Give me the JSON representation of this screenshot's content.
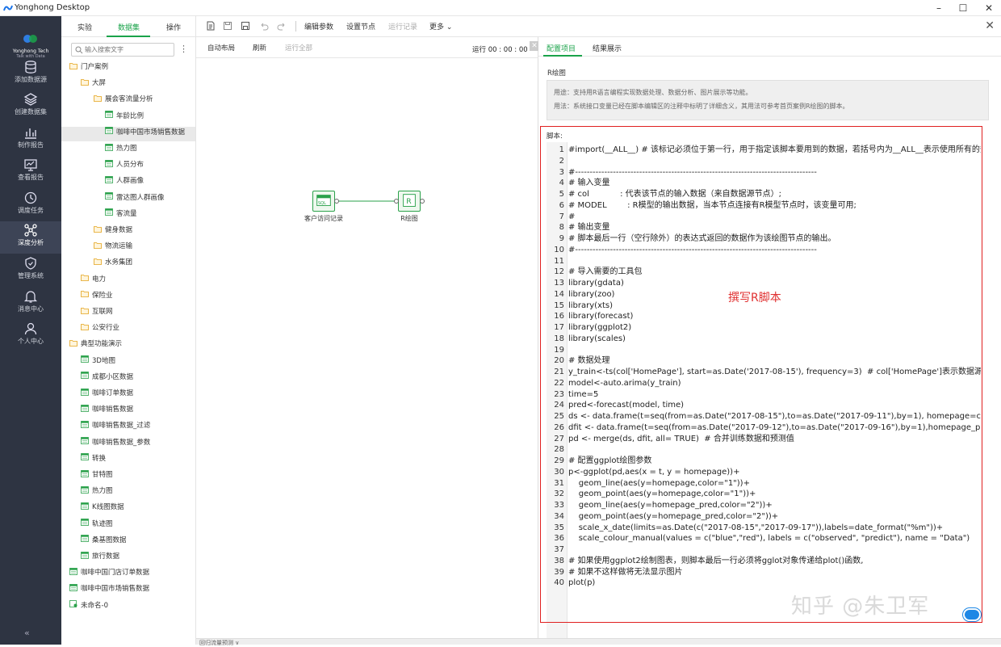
{
  "app": {
    "title": "Yonghong Desktop"
  },
  "brand": {
    "name": "Yonghong Tech",
    "tagline": "Talk with Data"
  },
  "leftnav": {
    "items": [
      {
        "label": "添加数据源",
        "icon": "database-icon"
      },
      {
        "label": "创建数据集",
        "icon": "layers-icon"
      },
      {
        "label": "制作报告",
        "icon": "bar-chart-icon"
      },
      {
        "label": "查看报告",
        "icon": "monitor-icon"
      },
      {
        "label": "调度任务",
        "icon": "clock-icon"
      },
      {
        "label": "深度分析",
        "icon": "network-icon",
        "active": true
      },
      {
        "label": "管理系统",
        "icon": "shield-icon"
      },
      {
        "label": "消息中心",
        "icon": "bell-icon"
      },
      {
        "label": "个人中心",
        "icon": "user-icon"
      }
    ],
    "collapse": "«"
  },
  "tree_tabs": {
    "experiment": "实验",
    "dataset": "数据集",
    "operation": "操作"
  },
  "search": {
    "placeholder": "输入搜索文字"
  },
  "tree": {
    "nodes": [
      "门户案例",
      "大屏",
      "展会客流量分析",
      "年龄比例",
      "咖啡中国市场销售数据",
      "热力图",
      "人员分布",
      "人群画像",
      "雷达图人群画像",
      "客流量",
      "健身数据",
      "物流运输",
      "水务集团",
      "电力",
      "保险业",
      "互联网",
      "公安行业",
      "典型功能演示",
      "3D地图",
      "成都小区数据",
      "咖啡订单数据",
      "咖啡销售数据",
      "咖啡销售数据_过滤",
      "咖啡销售数据_参数",
      "转换",
      "甘特图",
      "热力图",
      "K线图数据",
      "轨迹图",
      "桑基图数据",
      "旅行数据",
      "咖啡中国门店订单数据",
      "咖啡中国市场销售数据",
      "未命名-0"
    ]
  },
  "toolbar": {
    "edit_params": "编辑参数",
    "set_node": "设置节点",
    "run_log": "运行记录",
    "more": "更多"
  },
  "canvas": {
    "auto_layout": "自动布局",
    "refresh": "刷新",
    "run_all": "运行全部",
    "timer": "运行 00 : 00 : 00",
    "node1_label": "客户访问记录",
    "node1_icon_text": "SQL",
    "node2_label": "R绘图"
  },
  "config": {
    "tab_config": "配置项目",
    "tab_result": "结果展示",
    "section_title": "R绘图",
    "usage": "用途：支持用R语言编程实现数据处理、数据分析、图片展示等功能。",
    "usage_method": "用法：系统接口变量已经在脚本编辑区的注释中标明了详细含义，其用法可参考首页案例R绘图的脚本。",
    "script_label": "脚本:"
  },
  "code_lines": [
    "#import(__ALL__) # 该标记必须位于第一行，用于指定该脚本要用到的数据，若括号内为__ALL__表示使用所有的数据",
    "",
    "#-----------------------------------------------------------------------------------",
    "# 输入变量",
    "# col            : 代表该节点的输入数据（来自数据源节点）;",
    "# MODEL        : R模型的输出数据，当本节点连接有R模型节点时，该变量可用;",
    "#",
    "# 输出变量",
    "# 脚本最后一行（空行除外）的表达式返回的数据作为该绘图节点的输出。",
    "#-----------------------------------------------------------------------------------",
    "",
    "# 导入需要的工具包",
    "library(gdata)",
    "library(zoo)",
    "library(xts)",
    "library(forecast)",
    "library(ggplot2)",
    "library(scales)",
    "",
    "# 数据处理",
    "y_train<-ts(col['HomePage'], start=as.Date('2017-08-15'), frequency=3)  # col['HomePage']表示数据源中的HomePage列",
    "model<-auto.arima(y_train)",
    "time=5",
    "pred<-forecast(model, time)",
    "ds <- data.frame(t=seq(from=as.Date(\"2017-08-15\"),to=as.Date(\"2017-09-11\"),by=1), homepage=col$HomePage)",
    "dfit <- data.frame(t=seq(from=as.Date(\"2017-09-12\"),to=as.Date(\"2017-09-16\"),by=1),homepage_pred=pred$mean)",
    "pd <- merge(ds, dfit, all= TRUE)  # 合并训练数据和预测值",
    "",
    "# 配置ggplot绘图参数",
    "p<-ggplot(pd,aes(x = t, y = homepage))+",
    "    geom_line(aes(y=homepage,color=\"1\"))+",
    "    geom_point(aes(y=homepage,color=\"1\"))+",
    "    geom_line(aes(y=homepage_pred,color=\"2\"))+",
    "    geom_point(aes(y=homepage_pred,color=\"2\"))+",
    "    scale_x_date(limits=as.Date(c(\"2017-08-15\",\"2017-09-17\")),labels=date_format(\"%m\"))+",
    "    scale_colour_manual(values = c(\"blue\",\"red\"), labels = c(\"observed\", \"predict\"), name = \"Data\")",
    "",
    "# 如果使用ggplot2绘制图表，则脚本最后一行必须将gglot对象传递给plot()函数,",
    "# 如果不这样做将无法显示图片",
    "plot(p)"
  ],
  "annotation": "撰写R脚本",
  "watermark": "知乎 @朱卫军",
  "bottom": {
    "label": "回归流量预测 ∨"
  },
  "colors": {
    "accent": "#1aa34a",
    "nav_bg": "#2e3442",
    "highlight_box": "#e02020",
    "annotation": "#e03030"
  }
}
